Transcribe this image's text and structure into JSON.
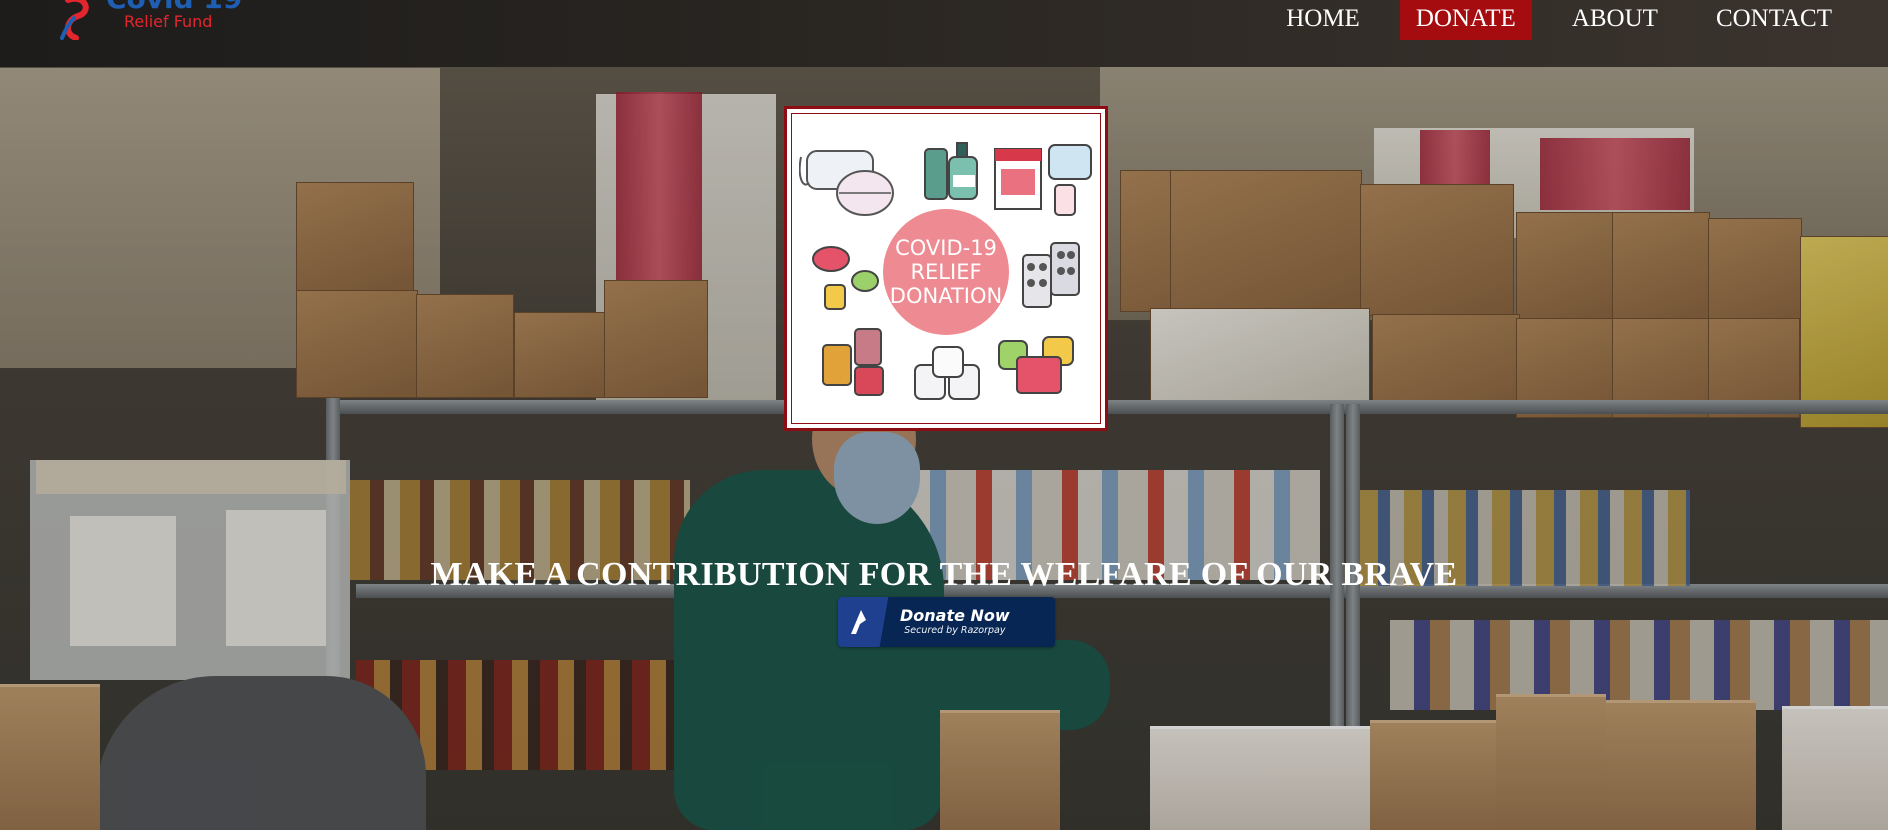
{
  "header": {
    "logo": {
      "title": "Covid 19",
      "subtitle": "Relief Fund"
    },
    "nav": [
      {
        "label": "HOME",
        "active": false
      },
      {
        "label": "DONATE",
        "active": true
      },
      {
        "label": "ABOUT",
        "active": false
      },
      {
        "label": "CONTACT",
        "active": false
      }
    ],
    "active_color": "#a50c10"
  },
  "hero": {
    "card_text": [
      "COVID-19",
      "RELIEF",
      "DONATION"
    ],
    "headline": "MAKE A CONTRIBUTION FOR THE WELFARE OF OUR BRAVE",
    "donate_button": {
      "title": "Donate Now",
      "subtitle": "Secured by Razorpay"
    },
    "button_color": "#072654"
  }
}
